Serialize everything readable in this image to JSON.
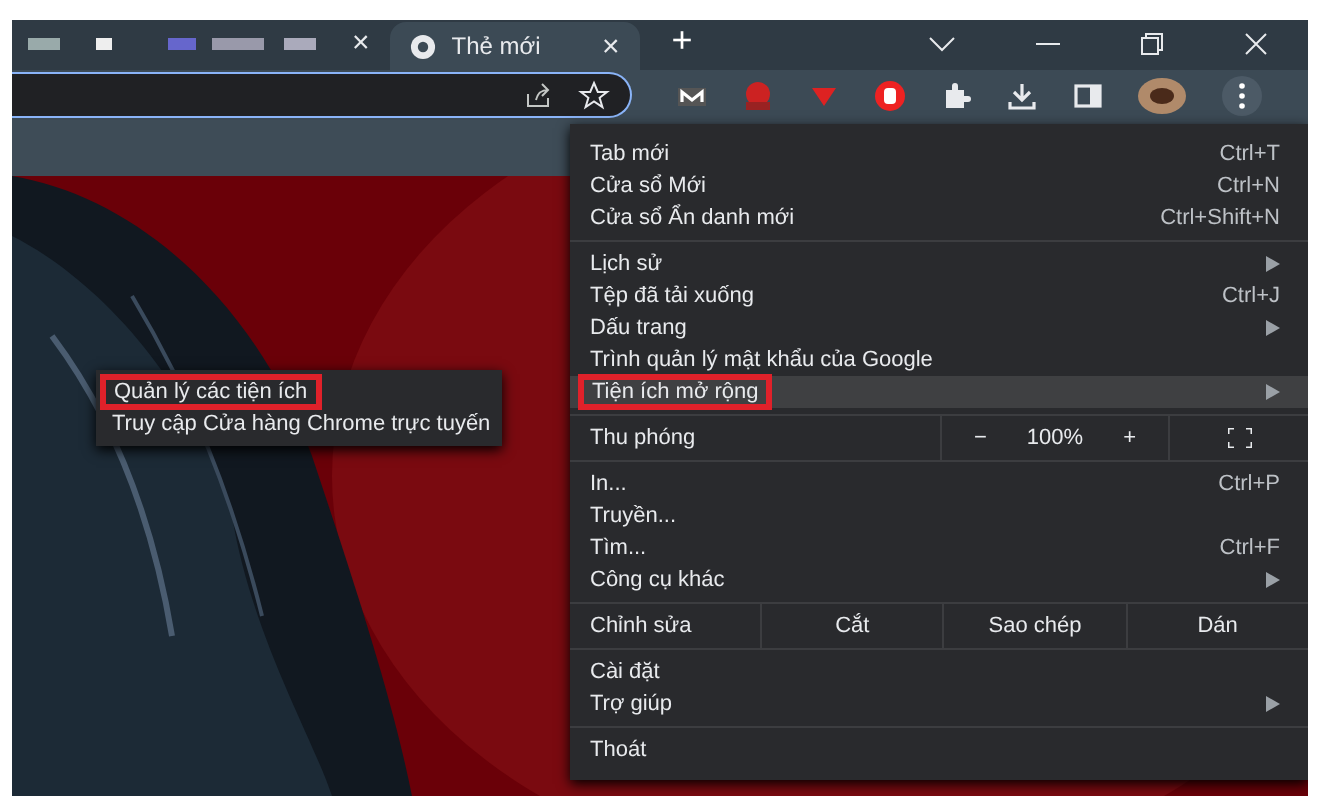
{
  "tabs": [
    {
      "title": "Thẻ mới",
      "selected": true,
      "close": "×"
    }
  ],
  "new_tab": "+",
  "inactive_tab_close": "×",
  "menu": {
    "sections": [
      [
        {
          "kind": "item",
          "label": "Tab mới",
          "shortcut": "Ctrl+T",
          "submenu": false,
          "selected": false,
          "annotated": false
        },
        {
          "kind": "item",
          "label": "Cửa sổ Mới",
          "shortcut": "Ctrl+N",
          "submenu": false,
          "selected": false,
          "annotated": false
        },
        {
          "kind": "item",
          "label": "Cửa sổ Ẩn danh mới",
          "shortcut": "Ctrl+Shift+N",
          "submenu": false,
          "selected": false,
          "annotated": false
        }
      ],
      [
        {
          "kind": "item",
          "label": "Lịch sử",
          "submenu": true,
          "selected": false,
          "annotated": false
        },
        {
          "kind": "item",
          "label": "Tệp đã tải xuống",
          "shortcut": "Ctrl+J",
          "submenu": false,
          "selected": false,
          "annotated": false
        },
        {
          "kind": "item",
          "label": "Dấu trang",
          "submenu": true,
          "selected": false,
          "annotated": false
        },
        {
          "kind": "item",
          "label": "Trình quản lý mật khẩu của Google",
          "submenu": false,
          "selected": false,
          "annotated": false
        },
        {
          "kind": "item",
          "label": "Tiện ích mở rộng",
          "submenu": true,
          "selected": true,
          "annotated": true
        }
      ],
      [
        {
          "kind": "zoom",
          "label": "Thu phóng",
          "minus": "−",
          "value": "100%",
          "plus": "+"
        }
      ],
      [
        {
          "kind": "item",
          "label": "In...",
          "shortcut": "Ctrl+P",
          "submenu": false,
          "selected": false,
          "annotated": false
        },
        {
          "kind": "item",
          "label": "Truyền...",
          "submenu": false,
          "selected": false,
          "annotated": false
        },
        {
          "kind": "item",
          "label": "Tìm...",
          "shortcut": "Ctrl+F",
          "submenu": false,
          "selected": false,
          "annotated": false
        },
        {
          "kind": "item",
          "label": "Công cụ khác",
          "submenu": true,
          "selected": false,
          "annotated": false
        }
      ],
      [
        {
          "kind": "edit",
          "label": "Chỉnh sửa",
          "actions": [
            "Cắt",
            "Sao chép",
            "Dán"
          ]
        }
      ],
      [
        {
          "kind": "item",
          "label": "Cài đặt",
          "submenu": false,
          "selected": false,
          "annotated": false
        },
        {
          "kind": "item",
          "label": "Trợ giúp",
          "submenu": true,
          "selected": false,
          "annotated": false
        }
      ],
      [
        {
          "kind": "item",
          "label": "Thoát",
          "submenu": false,
          "selected": false,
          "annotated": false
        }
      ]
    ]
  },
  "submenu": {
    "items": [
      {
        "label": "Quản lý các tiện ích",
        "annotated": true
      },
      {
        "label": "Truy cập Cửa hàng Chrome trực tuyến",
        "annotated": false
      }
    ]
  }
}
